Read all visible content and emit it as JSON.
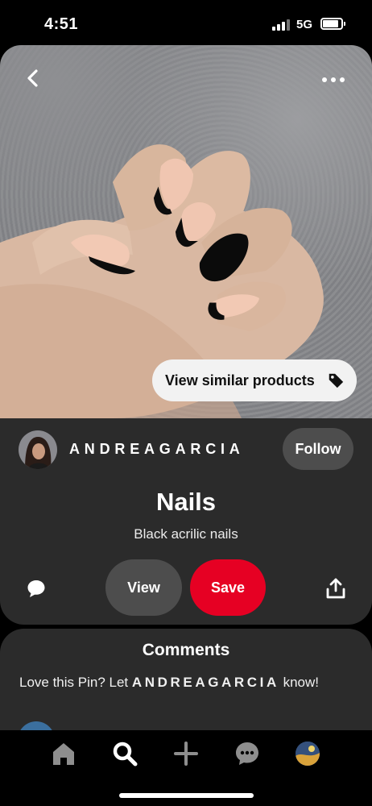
{
  "status_bar": {
    "time": "4:51",
    "network": "5G"
  },
  "pin": {
    "similar_products_label": "View similar products",
    "creator_name": "ANDREAGARCIA",
    "follow_label": "Follow",
    "title": "Nails",
    "description": "Black acrilic nails",
    "view_label": "View",
    "save_label": "Save"
  },
  "comments": {
    "title": "Comments",
    "prompt_before": "Love this Pin? Let ",
    "prompt_name": "ANDREAGARCIA",
    "prompt_after": " know!"
  },
  "icons": {
    "back": "chevron-left-icon",
    "more": "more-dots-icon",
    "tag": "tag-icon",
    "comment": "speech-bubble-icon",
    "share": "share-upload-icon",
    "nav": [
      "home-icon",
      "search-icon",
      "plus-icon",
      "messages-icon",
      "profile-avatar"
    ]
  },
  "colors": {
    "save": "#e60023",
    "card": "#2b2b2b",
    "button_gray": "#4d4d4d",
    "nav_active": "#ffffff",
    "nav_inactive": "#8e8e8e"
  },
  "bottom_nav": {
    "active_index": 1
  }
}
